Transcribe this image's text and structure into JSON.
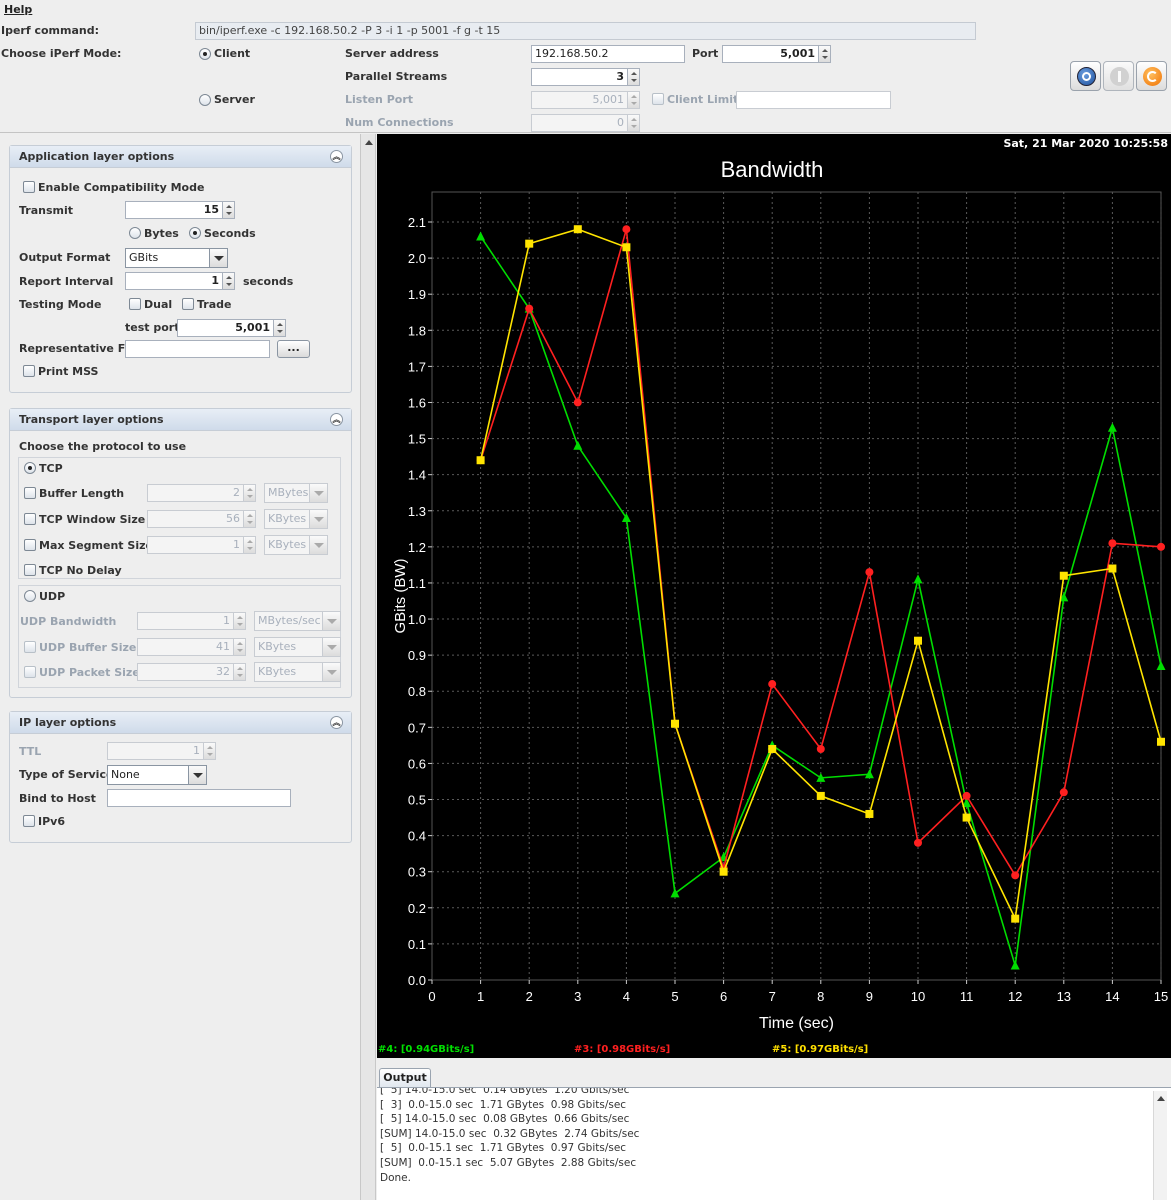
{
  "menu": {
    "help": "Help"
  },
  "top": {
    "iperf_command_label": "Iperf command:",
    "iperf_command": "bin/iperf.exe -c 192.168.50.2 -P 3 -i 1 -p 5001 -f g -t 15",
    "mode_label": "Choose iPerf Mode:",
    "client_label": "Client",
    "server_label": "Server",
    "server_address_label": "Server address",
    "server_address": "192.168.50.2",
    "port_label": "Port",
    "port": "5,001",
    "parallel_label": "Parallel Streams",
    "parallel": "3",
    "listen_port_label": "Listen Port",
    "listen_port": "5,001",
    "client_limit_label": "Client Limit",
    "num_conn_label": "Num Connections",
    "num_conn": "0"
  },
  "app_layer": {
    "title": "Application layer options",
    "compat_label": "Enable Compatibility Mode",
    "transmit_label": "Transmit",
    "transmit": "15",
    "bytes_label": "Bytes",
    "seconds_label": "Seconds",
    "output_format_label": "Output Format",
    "output_format": "GBits",
    "report_interval_label": "Report Interval",
    "report_interval": "1",
    "seconds_unit": "seconds",
    "testing_mode_label": "Testing Mode",
    "dual_label": "Dual",
    "trade_label": "Trade",
    "test_port_label": "test port",
    "test_port": "5,001",
    "rep_file_label": "Representative File",
    "browse_label": "...",
    "print_mss_label": "Print MSS"
  },
  "transport": {
    "title": "Transport layer options",
    "choose_label": "Choose the protocol to use",
    "tcp_label": "TCP",
    "buffer_length_label": "Buffer Length",
    "buffer_length": "2",
    "buffer_length_unit": "MBytes",
    "window_label": "TCP Window Size",
    "window": "56",
    "window_unit": "KBytes",
    "mss_label": "Max Segment Size",
    "mss": "1",
    "mss_unit": "KBytes",
    "nodelay_label": "TCP No Delay",
    "udp_label": "UDP",
    "udp_bw_label": "UDP Bandwidth",
    "udp_bw": "1",
    "udp_bw_unit": "MBytes/sec",
    "udp_buf_label": "UDP Buffer Size",
    "udp_buf": "41",
    "udp_buf_unit": "KBytes",
    "udp_pkt_label": "UDP Packet Size",
    "udp_pkt": "32",
    "udp_pkt_unit": "KBytes"
  },
  "ip_layer": {
    "title": "IP layer options",
    "ttl_label": "TTL",
    "ttl": "1",
    "tos_label": "Type of Service",
    "tos": "None",
    "bind_label": "Bind to Host",
    "ipv6_label": "IPv6"
  },
  "chart_header": {
    "timestamp": "Sat, 21 Mar 2020 10:25:58"
  },
  "legend": [
    {
      "text": "#4: [0.94GBits/s]",
      "color": "#00e000"
    },
    {
      "text": "#3: [0.98GBits/s]",
      "color": "#ff2020"
    },
    {
      "text": "#5: [0.97GBits/s]",
      "color": "#ffe000"
    }
  ],
  "chart_data": {
    "type": "line",
    "title": "Bandwidth",
    "xlabel": "Time (sec)",
    "ylabel": "GBits (BW)",
    "xlim": [
      0,
      15
    ],
    "ylim": [
      0,
      2.1
    ],
    "x_ticks": [
      "0",
      "1",
      "2",
      "3",
      "4",
      "5",
      "6",
      "7",
      "8",
      "9",
      "10",
      "11",
      "12",
      "13",
      "14",
      "15"
    ],
    "y_ticks": [
      "0.0",
      "0.1",
      "0.2",
      "0.3",
      "0.4",
      "0.5",
      "0.6",
      "0.7",
      "0.8",
      "0.9",
      "1.0",
      "1.1",
      "1.2",
      "1.3",
      "1.4",
      "1.5",
      "1.6",
      "1.7",
      "1.8",
      "1.9",
      "2.0",
      "2.1"
    ],
    "grid": true,
    "x": [
      1,
      2,
      3,
      4,
      5,
      6,
      7,
      8,
      9,
      10,
      11,
      12,
      13,
      14,
      15
    ],
    "series": [
      {
        "color": "#00dd00",
        "marker": "triangle",
        "values": [
          2.06,
          1.86,
          1.48,
          1.28,
          0.24,
          0.34,
          0.65,
          0.56,
          0.57,
          1.11,
          0.49,
          0.04,
          1.06,
          1.53,
          0.87
        ]
      },
      {
        "color": "#ff2020",
        "marker": "circle",
        "values": [
          1.44,
          1.86,
          1.6,
          2.08,
          0.71,
          0.31,
          0.82,
          0.64,
          1.13,
          0.38,
          0.51,
          0.29,
          0.52,
          1.21,
          1.2
        ]
      },
      {
        "color": "#ffe400",
        "marker": "square",
        "values": [
          1.44,
          2.04,
          2.08,
          2.03,
          0.71,
          0.3,
          0.64,
          0.51,
          0.46,
          0.94,
          0.45,
          0.17,
          1.12,
          1.14,
          0.66
        ]
      }
    ]
  },
  "output": {
    "tab_label": "Output",
    "lines": [
      "[  5] 14.0-15.0 sec  0.14 GBytes  1.20 Gbits/sec",
      "[  3]  0.0-15.0 sec  1.71 GBytes  0.98 Gbits/sec",
      "[  5] 14.0-15.0 sec  0.08 GBytes  0.66 Gbits/sec",
      "[SUM] 14.0-15.0 sec  0.32 GBytes  2.74 Gbits/sec",
      "[  5]  0.0-15.1 sec  1.71 GBytes  0.97 Gbits/sec",
      "[SUM]  0.0-15.1 sec  5.07 GBytes  2.88 Gbits/sec",
      "Done."
    ]
  }
}
